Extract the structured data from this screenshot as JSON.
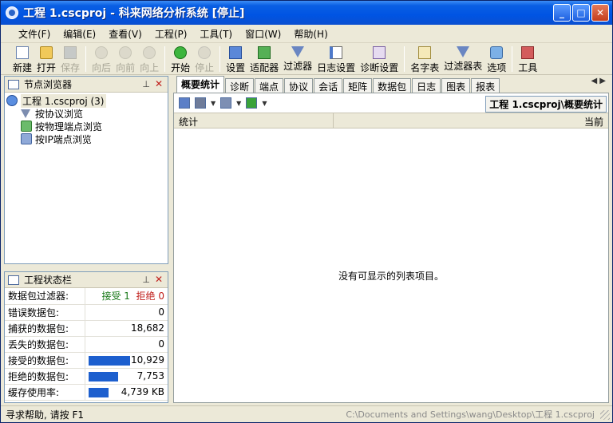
{
  "window": {
    "title": "工程 1.cscproj - 科来网络分析系统 [停止]",
    "controls": [
      "_",
      "□",
      "✕"
    ]
  },
  "menu": [
    "文件(F)",
    "编辑(E)",
    "查看(V)",
    "工程(P)",
    "工具(T)",
    "窗口(W)",
    "帮助(H)"
  ],
  "toolbar": {
    "new": "新建",
    "open": "打开",
    "save": "保存",
    "back": "向后",
    "forward": "向前",
    "up": "向上",
    "start": "开始",
    "stop": "停止",
    "settings": "设置",
    "adapter": "适配器",
    "filter": "过滤器",
    "log_settings": "日志设置",
    "diag_settings": "诊断设置",
    "names": "名字表",
    "filter_table": "过滤器表",
    "options": "选项",
    "tools": "工具"
  },
  "node_browser": {
    "title": "节点浏览器",
    "pin": "📌",
    "close": "✕",
    "root": "工程 1.cscproj (3)",
    "items": [
      "按协议浏览",
      "按物理端点浏览",
      "按IP端点浏览"
    ]
  },
  "project_status": {
    "title": "工程状态栏",
    "rows": [
      {
        "label": "数据包过滤器:",
        "value": "",
        "accept": "接受 1",
        "reject": "拒绝 0"
      },
      {
        "label": "错误数据包:",
        "value": "0"
      },
      {
        "label": "捕获的数据包:",
        "value": "18,682"
      },
      {
        "label": "丢失的数据包:",
        "value": "0"
      },
      {
        "label": "接受的数据包:",
        "value": "10,929",
        "fill": 0.58
      },
      {
        "label": "拒绝的数据包:",
        "value": "7,753",
        "fill": 0.41
      },
      {
        "label": "缓存使用率:",
        "value": "4,739 KB",
        "fill": 0.28
      }
    ]
  },
  "tabs": [
    "概要统计",
    "诊断",
    "端点",
    "协议",
    "会话",
    "矩阵",
    "数据包",
    "日志",
    "图表",
    "报表"
  ],
  "tab_scroll": "◀ ▶",
  "breadcrumb": "工程 1.cscproj\\概要统计",
  "list": {
    "col_stat": "统计",
    "col_current": "当前",
    "empty": "没有可显示的列表项目。"
  },
  "status": {
    "left": "寻求帮助, 请按 F1",
    "right": "C:\\Documents and Settings\\wang\\Desktop\\工程 1.cscproj"
  }
}
